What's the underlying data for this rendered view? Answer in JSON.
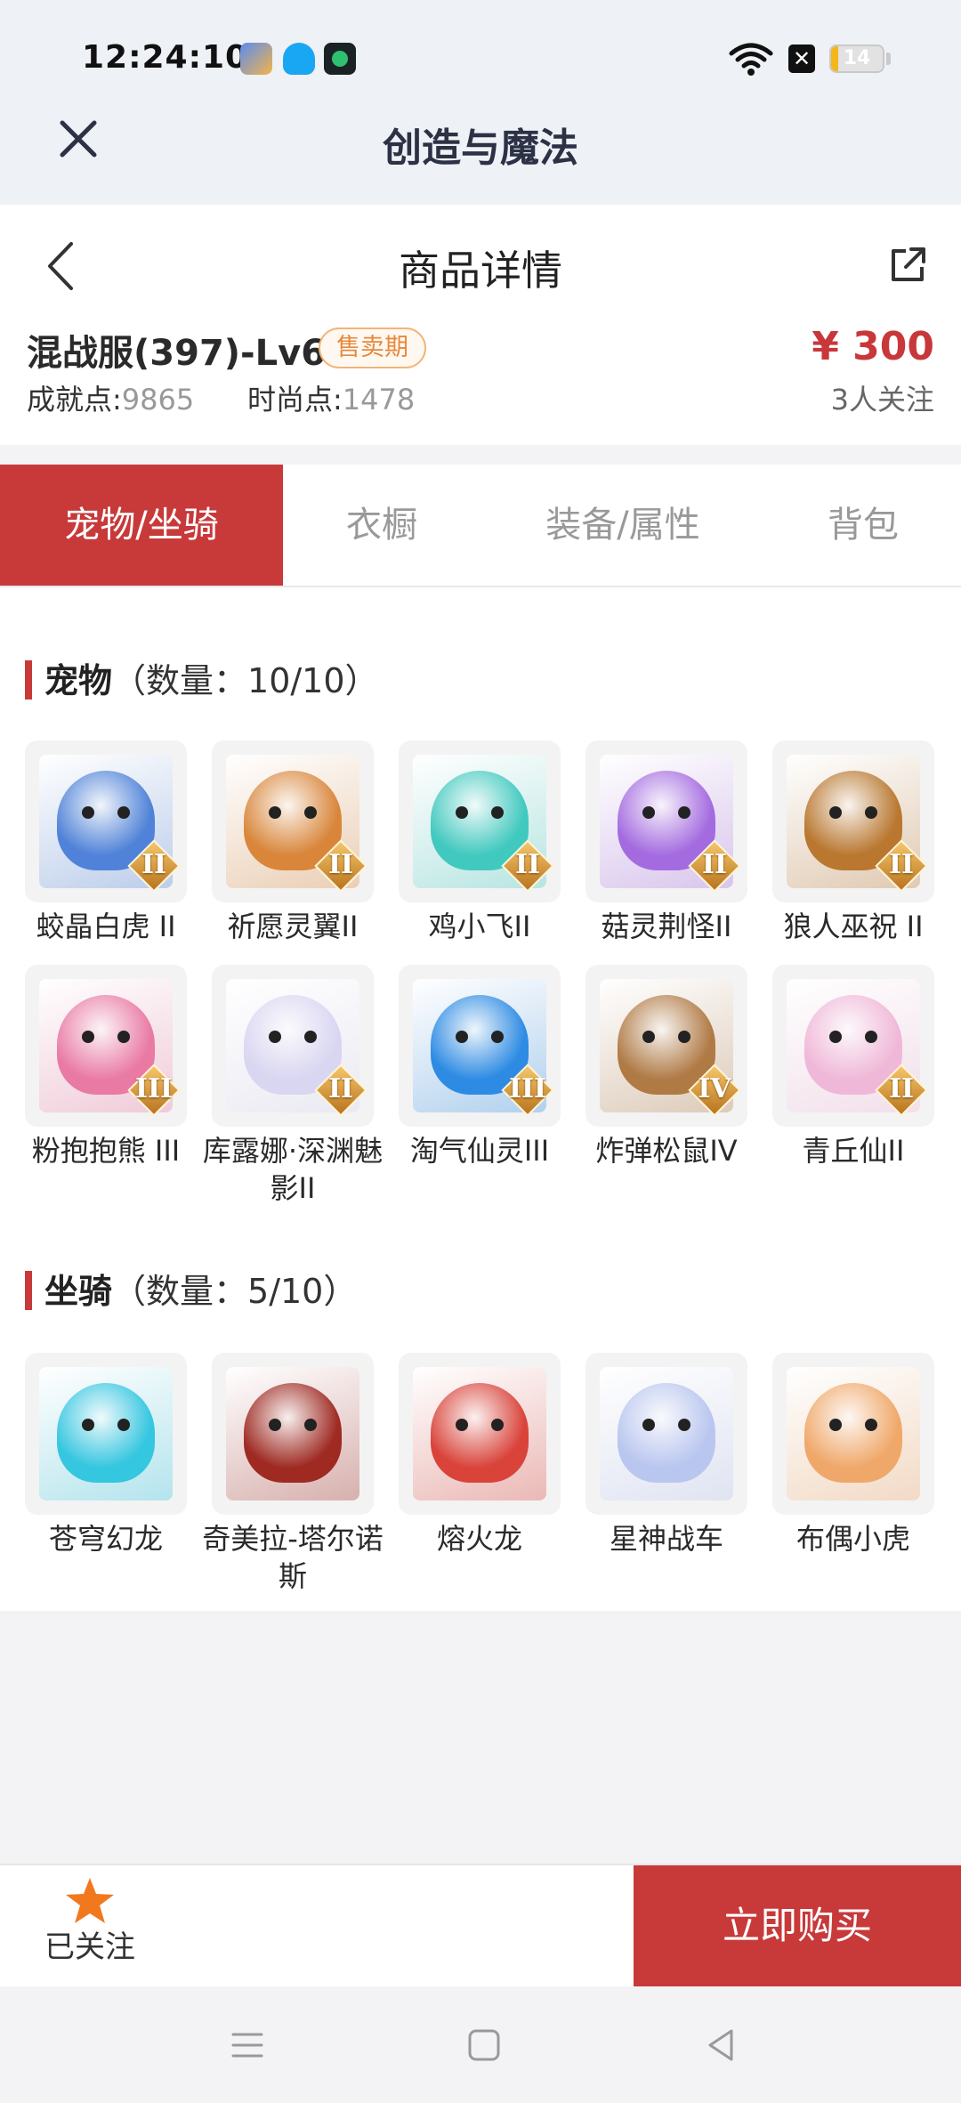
{
  "status_bar": {
    "time": "12:24:10",
    "battery": "14",
    "battery_level": 0.14
  },
  "app_bar": {
    "title": "创造与魔法"
  },
  "header": {
    "title": "商品详情"
  },
  "product": {
    "name": "混战服(397)-Lv69",
    "badge": "售卖期",
    "price": "¥ 300",
    "achievement_label": "成就点:",
    "achievement_value": "9865",
    "fashion_label": "时尚点:",
    "fashion_value": "1478",
    "followers": "3人关注"
  },
  "tabs": [
    {
      "label": "宠物/坐骑",
      "active": true
    },
    {
      "label": "衣橱",
      "active": false
    },
    {
      "label": "装备/属性",
      "active": false
    },
    {
      "label": "背包",
      "active": false
    }
  ],
  "pets": {
    "title": "宠物",
    "count": "（数量：10/10）",
    "items": [
      {
        "label": "蛟晶白虎 II",
        "rank": "II",
        "color": "#4f82d8"
      },
      {
        "label": "祈愿灵翼II",
        "rank": "II",
        "color": "#d9863a"
      },
      {
        "label": "鸡小飞II",
        "rank": "II",
        "color": "#41c9bf"
      },
      {
        "label": "菇灵荆怪II",
        "rank": "II",
        "color": "#a46be0"
      },
      {
        "label": "狼人巫祝 II",
        "rank": "II",
        "color": "#b9772f"
      },
      {
        "label": "粉抱抱熊 III",
        "rank": "III",
        "color": "#e97aa4"
      },
      {
        "label": "库露娜·深渊魅影II",
        "rank": "II",
        "color": "#d9d6f1"
      },
      {
        "label": "淘气仙灵III",
        "rank": "III",
        "color": "#2d8be3"
      },
      {
        "label": "炸弹松鼠IV",
        "rank": "IV",
        "color": "#b07a45"
      },
      {
        "label": "青丘仙II",
        "rank": "II",
        "color": "#f0b8d8"
      }
    ]
  },
  "mounts": {
    "title": "坐骑",
    "count": "（数量：5/10）",
    "items": [
      {
        "label": "苍穹幻龙",
        "color": "#35c6e0"
      },
      {
        "label": "奇美拉-塔尔诺斯",
        "color": "#9e2a22"
      },
      {
        "label": "熔火龙",
        "color": "#d9433a"
      },
      {
        "label": "星神战车",
        "color": "#b9c6ef"
      },
      {
        "label": "布偶小虎",
        "color": "#f0a86a"
      }
    ]
  },
  "bottom": {
    "follow_label": "已关注",
    "buy_label": "立即购买"
  },
  "colors": {
    "accent": "#c8393a",
    "badge": "#e7893c"
  }
}
